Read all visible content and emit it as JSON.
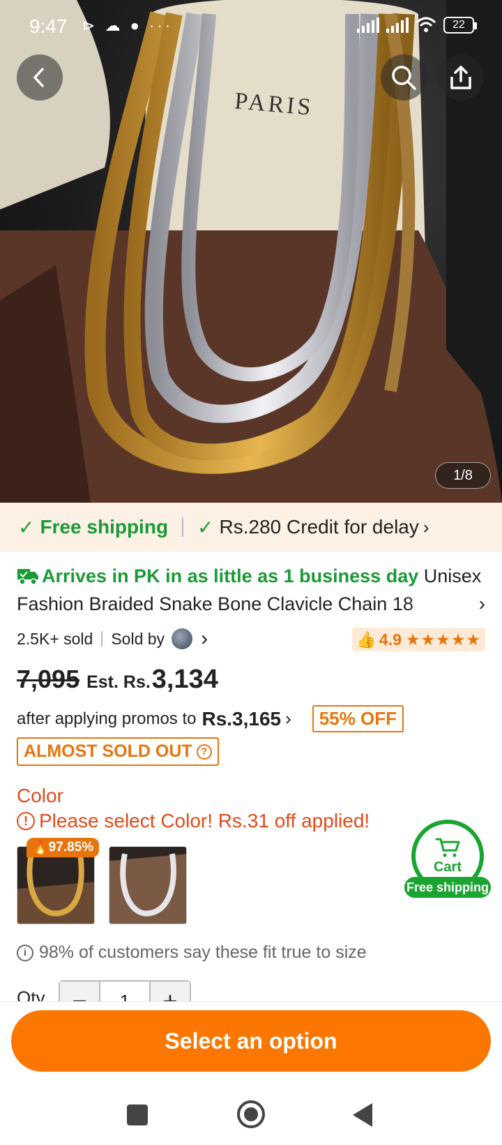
{
  "status_bar": {
    "time": "9:47",
    "left_icons": "⊳ ☁ ●  ···",
    "battery": "22"
  },
  "hero": {
    "image_desc_icon": "necklace-photo",
    "stand_text": "PARIS",
    "counter": "1/8"
  },
  "shipping": {
    "free": "Free shipping",
    "credit": "Rs.280 Credit for delay"
  },
  "product": {
    "arrives": "Arrives in PK in as little as 1 business day",
    "title_line1_rest": "Unisex",
    "title_line2": "Fashion Braided Snake Bone Clavicle Chain 18",
    "sold": "2.5K+ sold",
    "sold_by": "Sold by",
    "rating": "4.9",
    "stars": "★★★★★"
  },
  "price": {
    "old": "7,095",
    "est_label": "Est. Rs.",
    "est_value": "3,134",
    "promo_text": "after applying promos to",
    "promo_price": "Rs.3,165",
    "off_badge": "55% OFF",
    "soldout": "ALMOST SOLD OUT"
  },
  "color": {
    "label": "Color",
    "warning": "Please select Color! Rs.31 off applied!",
    "swatch_badge": "97.85%"
  },
  "cart": {
    "label": "Cart",
    "free_shipping": "Free shipping"
  },
  "fit": {
    "text": "98% of customers say these fit true to size"
  },
  "qty": {
    "label": "Qty",
    "value": "1",
    "minus": "−",
    "plus": "+"
  },
  "cta": {
    "label": "Select an option"
  },
  "colors": {
    "accent": "#fb7701",
    "green": "#1a9a36",
    "red": "#e24a1a"
  }
}
